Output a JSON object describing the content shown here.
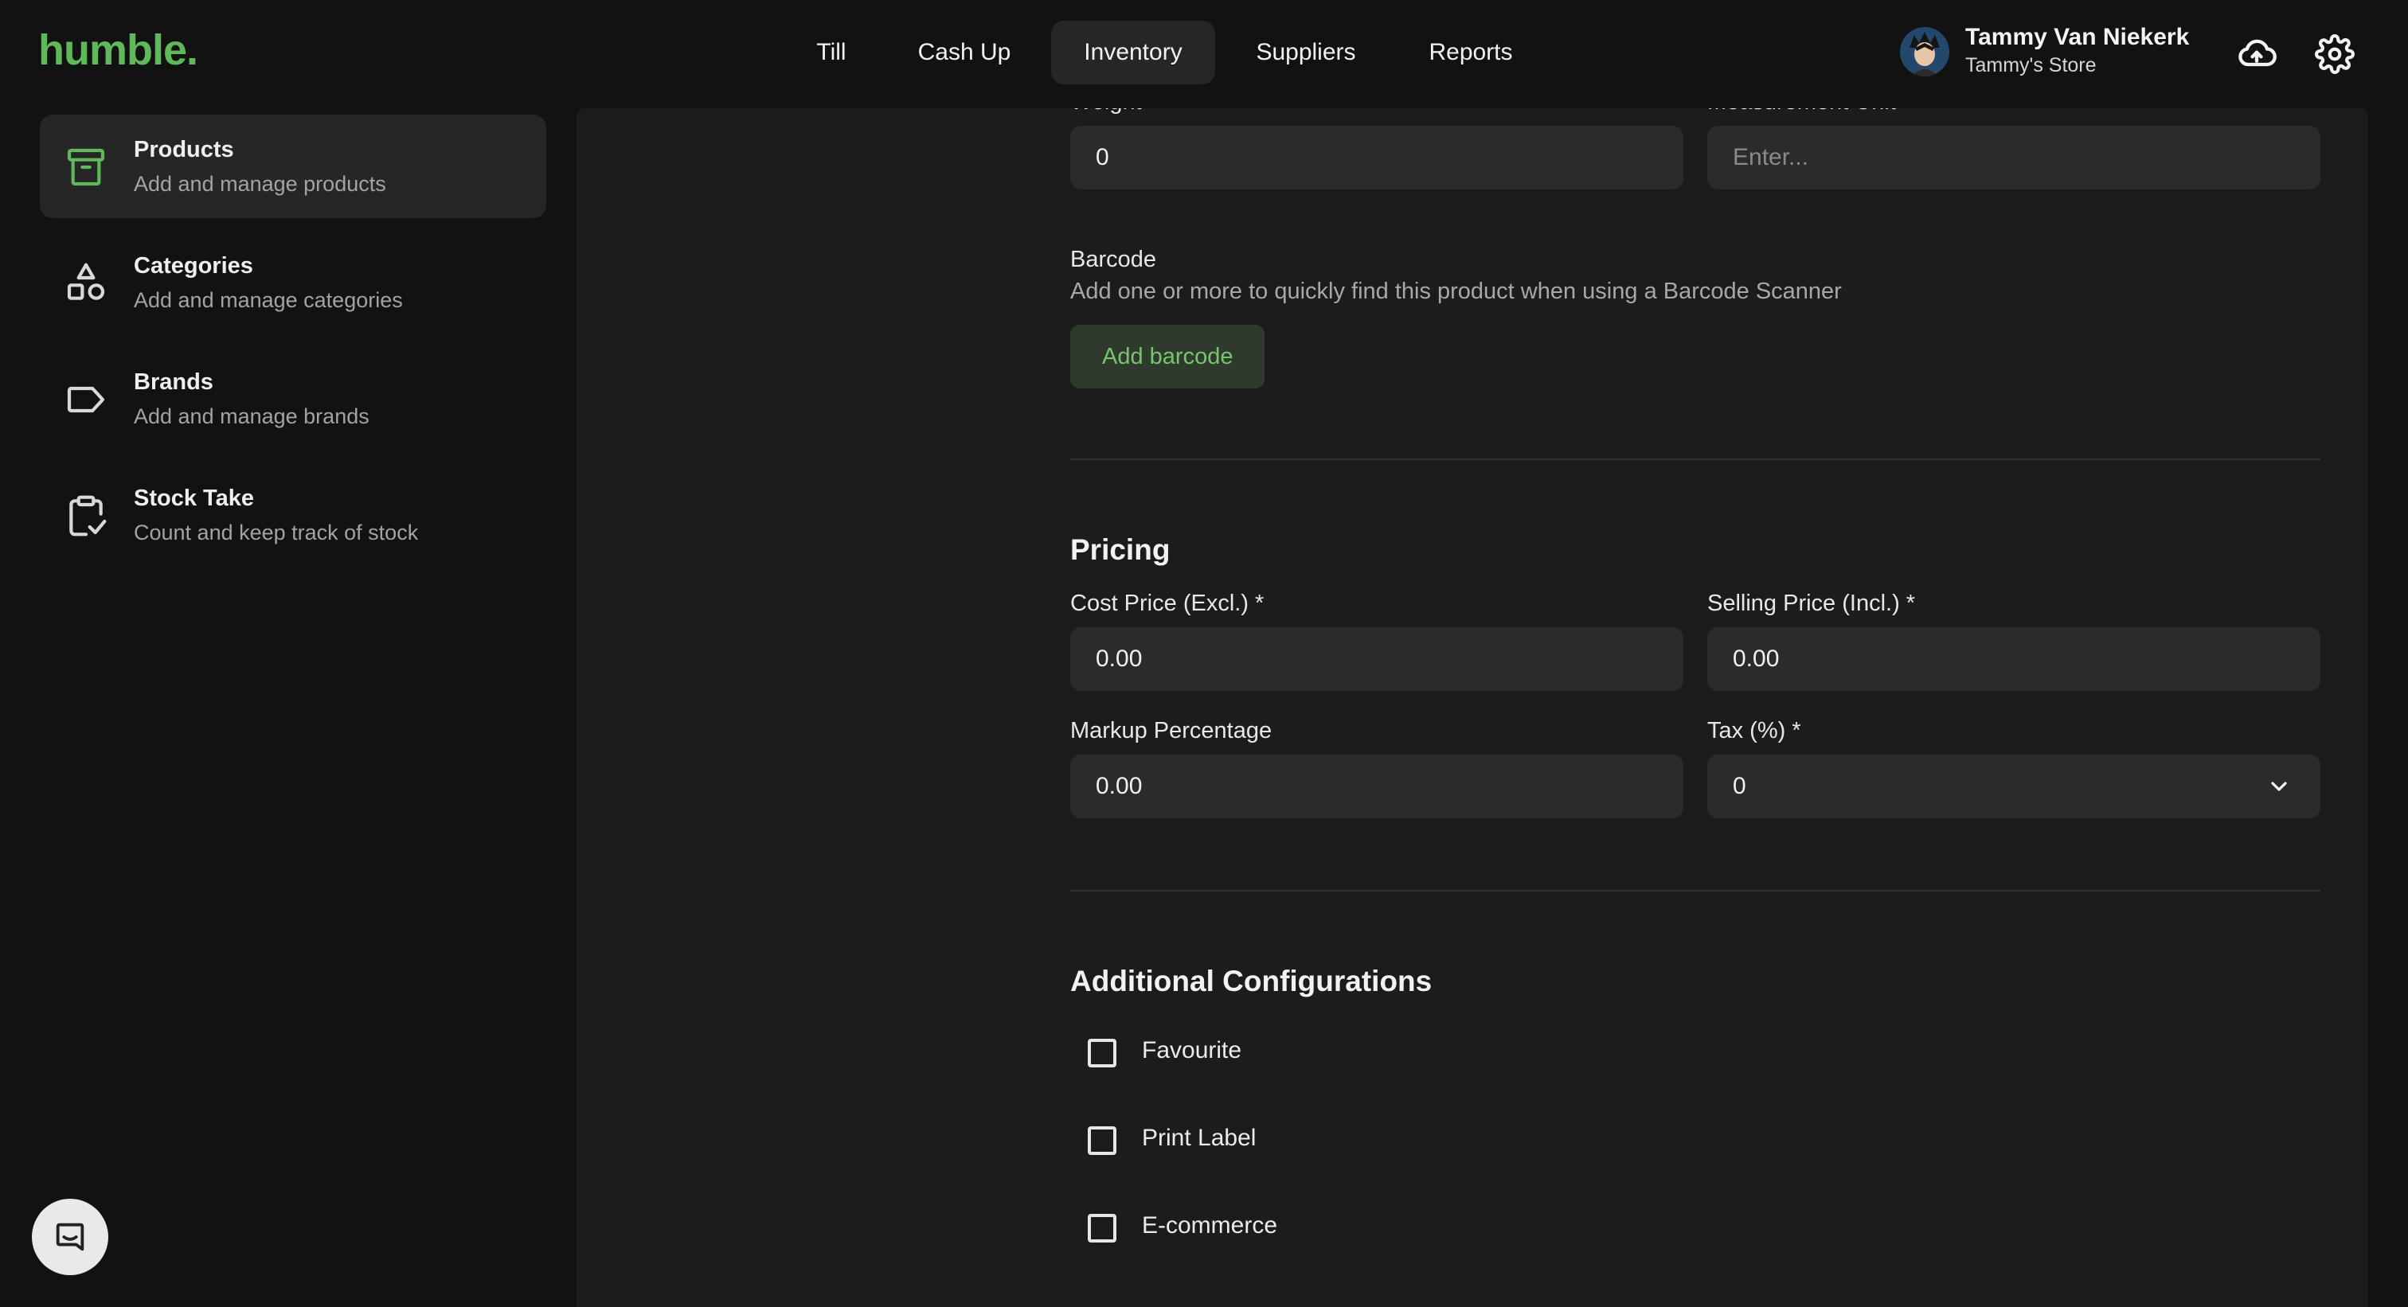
{
  "app": {
    "logo_text": "humble.",
    "brand_color": "#5fb85a"
  },
  "nav": {
    "tabs": [
      {
        "label": "Till",
        "active": false
      },
      {
        "label": "Cash Up",
        "active": false
      },
      {
        "label": "Inventory",
        "active": true
      },
      {
        "label": "Suppliers",
        "active": false
      },
      {
        "label": "Reports",
        "active": false
      }
    ]
  },
  "user": {
    "name": "Tammy Van Niekerk",
    "store": "Tammy's Store",
    "icons": [
      "cloud-upload-icon",
      "gear-icon"
    ]
  },
  "sidebar": {
    "items": [
      {
        "title": "Products",
        "subtitle": "Add and manage products",
        "icon": "archive-box-icon",
        "active": true
      },
      {
        "title": "Categories",
        "subtitle": "Add and manage categories",
        "icon": "shapes-icon",
        "active": false
      },
      {
        "title": "Brands",
        "subtitle": "Add and manage brands",
        "icon": "tag-icon",
        "active": false
      },
      {
        "title": "Stock Take",
        "subtitle": "Count and keep track of stock",
        "icon": "clipboard-check-icon",
        "active": false
      }
    ],
    "chat_icon": "chat-icon"
  },
  "form": {
    "weight": {
      "label": "Weight",
      "value": "0"
    },
    "measurement_unit": {
      "label": "Measurement Unit",
      "placeholder": "Enter..."
    },
    "barcode": {
      "label": "Barcode",
      "description": "Add one or more to quickly find this product when using a Barcode Scanner",
      "button_label": "Add barcode"
    },
    "pricing": {
      "title": "Pricing",
      "cost_price": {
        "label": "Cost Price (Excl.) *",
        "value": "0.00"
      },
      "selling_price": {
        "label": "Selling Price (Incl.) *",
        "value": "0.00"
      },
      "markup": {
        "label": "Markup Percentage",
        "value": "0.00"
      },
      "tax": {
        "label": "Tax (%) *",
        "value": "0"
      }
    },
    "additional": {
      "title": "Additional Configurations",
      "options": [
        {
          "label": "Favourite",
          "checked": false
        },
        {
          "label": "Print Label",
          "checked": false
        },
        {
          "label": "E-commerce",
          "checked": false
        }
      ]
    }
  }
}
